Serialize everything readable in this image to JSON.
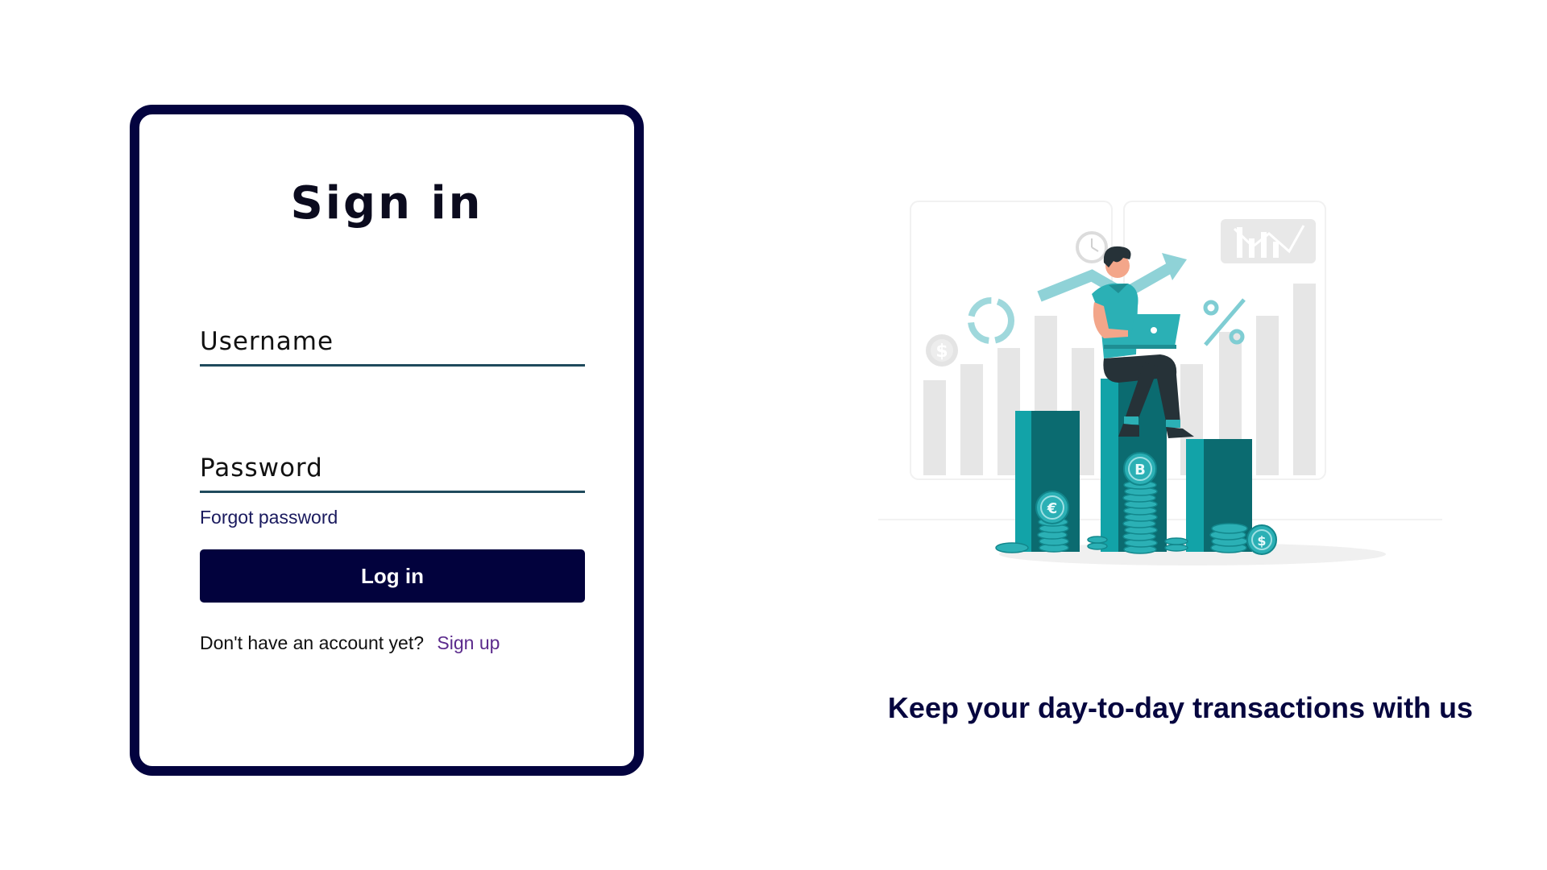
{
  "signin": {
    "title": "Sign in",
    "username_placeholder": "Username",
    "password_placeholder": "Password",
    "forgot_password": "Forgot password",
    "login_button": "Log in",
    "no_account_text": "Don't have an account yet?",
    "signup_link": "Sign up"
  },
  "illustration": {
    "tagline": "Keep your day-to-day transactions with us",
    "icons": [
      "clock-icon",
      "dollar-coin-icon",
      "donut-chart-icon",
      "percent-icon",
      "trend-arrow-icon",
      "bar-chart-icon",
      "euro-coin-icon",
      "bitcoin-coin-icon",
      "laptop-icon"
    ]
  },
  "colors": {
    "brand_navy": "#02023d",
    "card_border": "#03033f",
    "input_underline": "#1f4a5c",
    "teal": "#0fa3a8",
    "teal_dark": "#0b6b70",
    "link_purple": "#5b2a8c"
  }
}
